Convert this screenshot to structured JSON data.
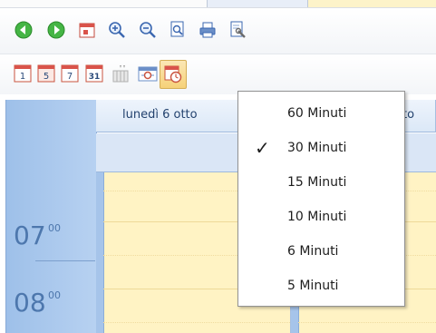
{
  "toolbar_row1": [
    {
      "name": "back-arrow-icon",
      "color": "#3aa83a"
    },
    {
      "name": "forward-arrow-icon",
      "color": "#3aa83a"
    },
    {
      "name": "calendar-view-icon",
      "color": "#d84a3a"
    },
    {
      "name": "zoom-in-icon",
      "color": "#3b67b0"
    },
    {
      "name": "zoom-out-icon",
      "color": "#3b67b0"
    },
    {
      "name": "print-preview-icon",
      "color": "#3b67b0"
    },
    {
      "name": "print-icon",
      "color": "#3b67b0"
    },
    {
      "name": "page-setup-icon",
      "color": "#3b67b0"
    }
  ],
  "toolbar_row2": [
    {
      "name": "day-view-icon",
      "label": "1"
    },
    {
      "name": "work-week-view-icon",
      "label": "5"
    },
    {
      "name": "week-view-icon",
      "label": "7"
    },
    {
      "name": "month-view-icon",
      "label": "31"
    },
    {
      "name": "timeline-view-icon",
      "label": ""
    },
    {
      "name": "resource-view-icon",
      "label": ""
    },
    {
      "name": "time-scale-icon",
      "label": ""
    }
  ],
  "calendar": {
    "days": [
      {
        "header": "lunedì 6 otto"
      },
      {
        "header": "otto"
      }
    ],
    "times": [
      {
        "hour": "07",
        "minutes": "00"
      },
      {
        "hour": "08",
        "minutes": "00"
      }
    ]
  },
  "time_scale_menu": {
    "items": [
      {
        "label": "60 Minuti",
        "checked": false
      },
      {
        "label": "30 Minuti",
        "checked": true
      },
      {
        "label": "15 Minuti",
        "checked": false
      },
      {
        "label": "10 Minuti",
        "checked": false
      },
      {
        "label": "6 Minuti",
        "checked": false
      },
      {
        "label": "5 Minuti",
        "checked": false
      }
    ],
    "check_mark": "✓"
  },
  "colors": {
    "time_column": "#a8c6ee",
    "day_body": "#fff3c4",
    "header_text": "#23426e",
    "time_text": "#4d77ad"
  }
}
